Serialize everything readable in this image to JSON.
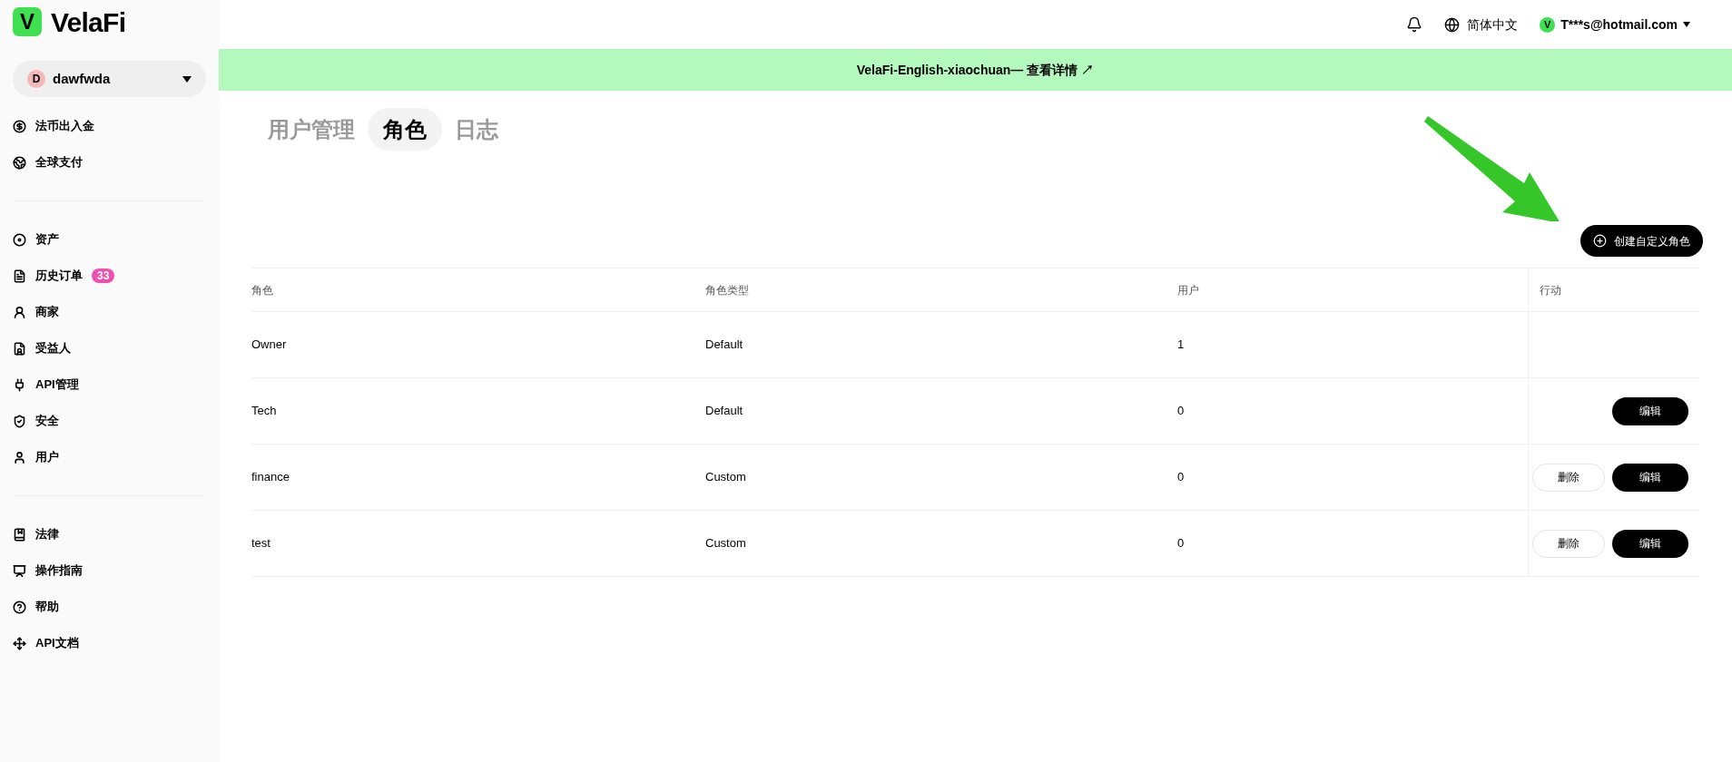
{
  "brand": {
    "logo_letter": "V",
    "name": "VelaFi"
  },
  "account_switch": {
    "avatar": "D",
    "name": "dawfwda"
  },
  "sidebar": {
    "groups": [
      [
        {
          "label": "法币出入金",
          "kind": "fiat"
        },
        {
          "label": "全球支付",
          "kind": "globe"
        }
      ],
      [
        {
          "label": "资产",
          "kind": "asset"
        },
        {
          "label": "历史订单",
          "kind": "orders",
          "badge": "33"
        },
        {
          "label": "商家",
          "kind": "merchant"
        },
        {
          "label": "受益人",
          "kind": "payee"
        },
        {
          "label": "API管理",
          "kind": "plug"
        },
        {
          "label": "安全",
          "kind": "shield"
        },
        {
          "label": "用户",
          "kind": "user"
        }
      ],
      [
        {
          "label": "法律",
          "kind": "book"
        },
        {
          "label": "操作指南",
          "kind": "guide"
        },
        {
          "label": "帮助",
          "kind": "help"
        },
        {
          "label": "API文档",
          "kind": "docs"
        }
      ]
    ]
  },
  "topbar": {
    "language": "简体中文",
    "user_avatar": "V",
    "user_email": "T***s@hotmail.com"
  },
  "banner": {
    "text": "VelaFi-English-xiaochuan—",
    "link": "查看详情 ↗"
  },
  "tabs": [
    {
      "label": "用户管理",
      "selected": false
    },
    {
      "label": "角色",
      "selected": true
    },
    {
      "label": "日志",
      "selected": false
    }
  ],
  "create_button": "创建自定义角色",
  "table": {
    "columns": [
      "角色",
      "角色类型",
      "用户",
      "行动"
    ],
    "rows": [
      {
        "role": "Owner",
        "type": "Default",
        "users": "1",
        "actions": []
      },
      {
        "role": "Tech",
        "type": "Default",
        "users": "0",
        "actions": [
          {
            "kind": "edit",
            "label": "编辑"
          }
        ]
      },
      {
        "role": "finance",
        "type": "Custom",
        "users": "0",
        "actions": [
          {
            "kind": "delete",
            "label": "删除"
          },
          {
            "kind": "edit",
            "label": "编辑"
          }
        ]
      },
      {
        "role": "test",
        "type": "Custom",
        "users": "0",
        "actions": [
          {
            "kind": "delete",
            "label": "删除"
          },
          {
            "kind": "edit",
            "label": "编辑"
          }
        ]
      }
    ]
  }
}
